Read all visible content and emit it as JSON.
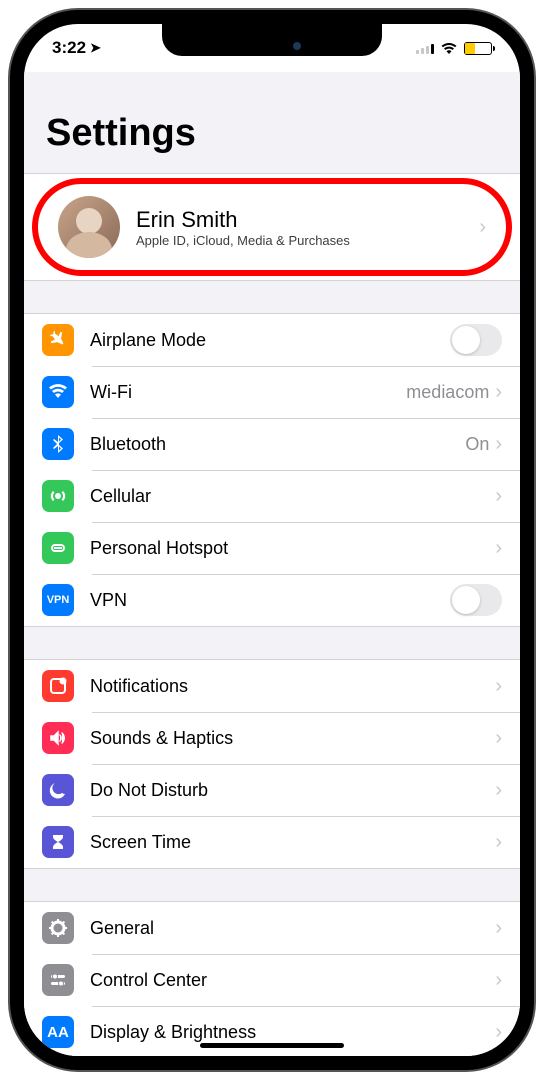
{
  "status": {
    "time": "3:22",
    "location_icon": "➤"
  },
  "page_title": "Settings",
  "profile": {
    "name": "Erin Smith",
    "subtitle": "Apple ID, iCloud, Media & Purchases"
  },
  "group1": {
    "airplane": {
      "label": "Airplane Mode"
    },
    "wifi": {
      "label": "Wi-Fi",
      "value": "mediacom"
    },
    "bluetooth": {
      "label": "Bluetooth",
      "value": "On"
    },
    "cellular": {
      "label": "Cellular"
    },
    "hotspot": {
      "label": "Personal Hotspot"
    },
    "vpn": {
      "label": "VPN",
      "badge": "VPN"
    }
  },
  "group2": {
    "notifications": {
      "label": "Notifications"
    },
    "sounds": {
      "label": "Sounds & Haptics"
    },
    "dnd": {
      "label": "Do Not Disturb"
    },
    "screentime": {
      "label": "Screen Time"
    }
  },
  "group3": {
    "general": {
      "label": "General"
    },
    "control": {
      "label": "Control Center"
    },
    "display": {
      "label": "Display & Brightness",
      "badge": "AA"
    }
  },
  "icons": {
    "airplane": "✈",
    "wifi_glyph": "⌔",
    "bluetooth": "∗",
    "cellular": "⏚",
    "hotspot": "⥀",
    "notification": "◻",
    "speaker": "◀))",
    "moon": "☾",
    "hourglass": "⧗",
    "gear": "⚙",
    "toggles": "⥃"
  }
}
